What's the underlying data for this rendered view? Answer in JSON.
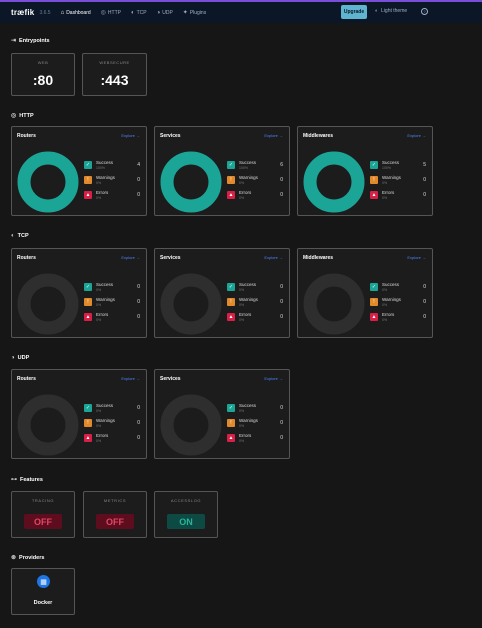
{
  "nav": {
    "logo": "træfik",
    "version": "3.6.5",
    "links": [
      {
        "label": "Dashboard",
        "icon": "home-icon",
        "active": true
      },
      {
        "label": "HTTP",
        "icon": "globe-icon"
      },
      {
        "label": "TCP",
        "icon": "tcp-icon"
      },
      {
        "label": "UDP",
        "icon": "udp-icon"
      },
      {
        "label": "Plugins",
        "icon": "puzzle-icon"
      }
    ],
    "upgrade": "Upgrade",
    "theme": "Light theme",
    "help": "?"
  },
  "sections": {
    "entrypoints": "Entrypoints",
    "http": "HTTP",
    "tcp": "TCP",
    "udp": "UDP",
    "features": "Features",
    "providers": "Providers"
  },
  "entrypoints": [
    {
      "name": "WEB",
      "port": ":80"
    },
    {
      "name": "WEBSECURE",
      "port": ":443"
    }
  ],
  "labels": {
    "explore": "Explore →",
    "success": "Success",
    "warnings": "Warnings",
    "errors": "Errors"
  },
  "http": [
    {
      "title": "Routers",
      "success": "4",
      "success_pct": "100%",
      "warnings": "0",
      "warnings_pct": "0%",
      "errors": "0",
      "errors_pct": "0%"
    },
    {
      "title": "Services",
      "success": "6",
      "success_pct": "100%",
      "warnings": "0",
      "warnings_pct": "0%",
      "errors": "0",
      "errors_pct": "0%"
    },
    {
      "title": "Middlewares",
      "success": "5",
      "success_pct": "100%",
      "warnings": "0",
      "warnings_pct": "0%",
      "errors": "0",
      "errors_pct": "0%"
    }
  ],
  "tcp": [
    {
      "title": "Routers",
      "success": "0",
      "success_pct": "0%",
      "warnings": "0",
      "warnings_pct": "0%",
      "errors": "0",
      "errors_pct": "0%"
    },
    {
      "title": "Services",
      "success": "0",
      "success_pct": "0%",
      "warnings": "0",
      "warnings_pct": "0%",
      "errors": "0",
      "errors_pct": "0%"
    },
    {
      "title": "Middlewares",
      "success": "0",
      "success_pct": "0%",
      "warnings": "0",
      "warnings_pct": "0%",
      "errors": "0",
      "errors_pct": "0%"
    }
  ],
  "udp": [
    {
      "title": "Routers",
      "success": "0",
      "success_pct": "0%",
      "warnings": "0",
      "warnings_pct": "0%",
      "errors": "0",
      "errors_pct": "0%"
    },
    {
      "title": "Services",
      "success": "0",
      "success_pct": "0%",
      "warnings": "0",
      "warnings_pct": "0%",
      "errors": "0",
      "errors_pct": "0%"
    }
  ],
  "features": [
    {
      "name": "TRACING",
      "state": "OFF"
    },
    {
      "name": "METRICS",
      "state": "OFF"
    },
    {
      "name": "ACCESSLOG",
      "state": "ON"
    }
  ],
  "providers": [
    {
      "name": "Docker",
      "icon": "docker-icon"
    }
  ],
  "colors": {
    "success": "#1aa597",
    "warning": "#e08a2c",
    "error": "#d81f46",
    "empty": "#2e2e2e",
    "accent": "#4d87ff"
  }
}
